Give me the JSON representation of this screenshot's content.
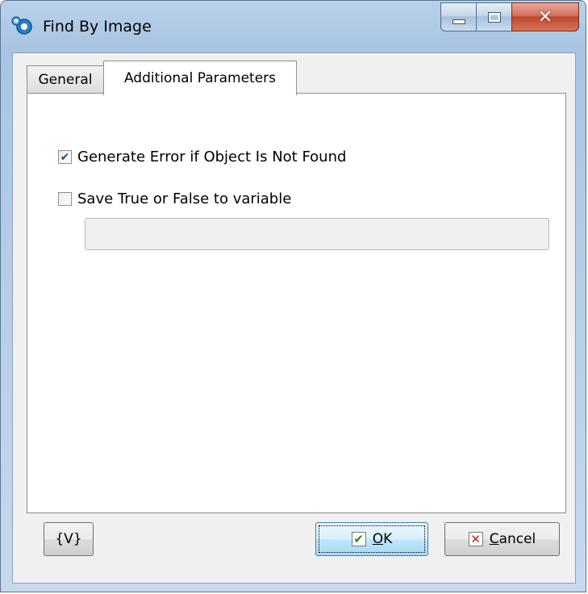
{
  "window": {
    "title": "Find By Image",
    "app_icon": "gears-icon",
    "caption_buttons": [
      "minimize-icon",
      "maximize-icon",
      "close-icon"
    ]
  },
  "tabs": [
    {
      "label": "General",
      "active": false
    },
    {
      "label": "Additional Parameters",
      "active": true
    }
  ],
  "options": {
    "generate_error": {
      "label": "Generate Error if Object Is Not Found",
      "checked": true
    },
    "save_true_false": {
      "label": "Save True or False to variable",
      "checked": false
    },
    "variable_value": ""
  },
  "buttons": {
    "variables_label": "{V}",
    "ok_mnemonic": "O",
    "ok_rest": "K",
    "cancel_mnemonic": "C",
    "cancel_rest": "ancel"
  },
  "colors": {
    "ok_check": "#1f8a1f",
    "cancel_x": "#d21c1c",
    "checkbox_check": "#2a4b8d"
  }
}
